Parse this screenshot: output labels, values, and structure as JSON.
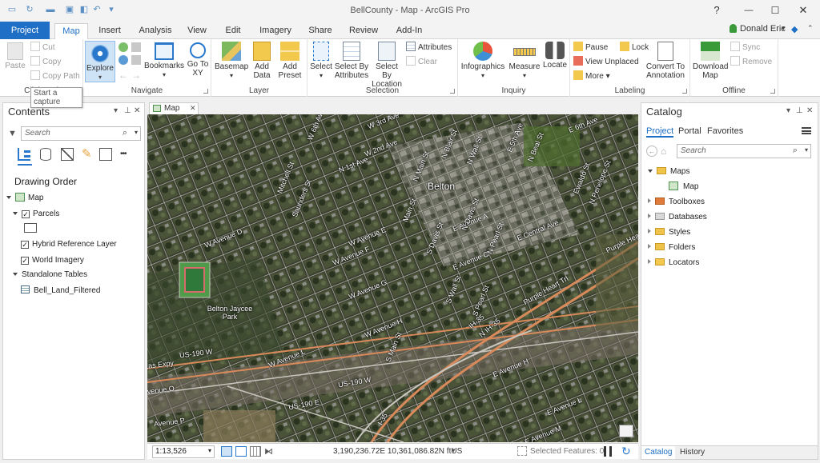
{
  "window": {
    "title": "BellCounty - Map - ArcGIS Pro",
    "user": "Donald Eric",
    "user_caret": "▾",
    "help": "?",
    "minimize": "—",
    "maximize": "☐",
    "close": "✕"
  },
  "ribbon_tabs": [
    "Project",
    "Map",
    "Insert",
    "Analysis",
    "View",
    "Edit",
    "Imagery",
    "Share",
    "Review",
    "Add-In"
  ],
  "ribbon": {
    "clipboard": {
      "label": "Clipboard",
      "paste": "Paste",
      "cut": "Cut",
      "copy": "Copy",
      "copy_path": "Copy Path",
      "tooltip": "Start a capture"
    },
    "navigate": {
      "label": "Navigate",
      "explore": "Explore",
      "bookmarks": "Bookmarks",
      "go_to_xy": "Go To XY"
    },
    "layer": {
      "label": "Layer",
      "basemap": "Basemap",
      "add_data": "Add Data",
      "add_preset": "Add Preset"
    },
    "selection": {
      "label": "Selection",
      "select": "Select",
      "select_by_attributes": "Select By Attributes",
      "select_by_location": "Select By Location",
      "attributes": "Attributes",
      "clear": "Clear"
    },
    "inquiry": {
      "label": "Inquiry",
      "infographics": "Infographics",
      "measure": "Measure",
      "locate": "Locate"
    },
    "labeling": {
      "label": "Labeling",
      "pause": "Pause",
      "lock": "Lock",
      "view_unplaced": "View Unplaced",
      "more": "More",
      "convert_to_annotation": "Convert To Annotation"
    },
    "offline": {
      "label": "Offline",
      "download_map": "Download Map",
      "sync": "Sync",
      "remove": "Remove"
    }
  },
  "contents": {
    "title": "Contents",
    "search_placeholder": "Search",
    "drawing_order": "Drawing Order",
    "more": "•••",
    "layers": [
      {
        "name": "Map"
      },
      {
        "name": "Parcels",
        "checked": true
      },
      {
        "name": "Hybrid Reference Layer",
        "checked": true
      },
      {
        "name": "World Imagery",
        "checked": true
      },
      {
        "name": "Standalone Tables"
      },
      {
        "name": "Bell_Land_Filtered"
      }
    ]
  },
  "map_tab": {
    "label": "Map"
  },
  "map_labels": [
    "W 2nd Ave",
    "N 1st Ave",
    "Belton",
    "W Avenue D",
    "W Avenue E",
    "W Avenue F",
    "W Avenue G",
    "W Avenue H",
    "E Avenue A",
    "E Central Ave",
    "E Avenue C",
    "Purple Heart Trl",
    "Purple Heart Trl",
    "US-190 W",
    "US-190 W",
    "US-190 E",
    "Belton Jaycee Park",
    "Main St",
    "Saunders St",
    "Mitchell St",
    "N Main St",
    "S Main St",
    "S Wall St",
    "S Pearl St",
    "N Wall St",
    "N Beal St",
    "W 6th Ave",
    "E 6th Ave",
    "E 5th Ave",
    "Ewaldo St",
    "IH-35",
    "N IH-35",
    "N Penelope St",
    "N Blair St",
    "E Avenue H",
    "E Avenue L",
    "I-35",
    "Avenue O",
    "Avenue P",
    "Las Expy",
    "N Davis St",
    "N Pearl St",
    "S Davis St",
    "W Avenue L",
    "W 3rd Ave",
    "E Avenue M"
  ],
  "status": {
    "scale": "1:13,526",
    "coordinates": "3,190,236.72E 10,361,086.82N ftUS",
    "selected_features": "Selected Features: 0"
  },
  "catalog": {
    "title": "Catalog",
    "tabs": [
      "Project",
      "Portal",
      "Favorites"
    ],
    "search_placeholder": "Search",
    "items": [
      {
        "name": "Maps",
        "expanded": true
      },
      {
        "name": "Map",
        "child": true
      },
      {
        "name": "Toolboxes"
      },
      {
        "name": "Databases"
      },
      {
        "name": "Styles"
      },
      {
        "name": "Folders"
      },
      {
        "name": "Locators"
      }
    ],
    "bottom_tabs": [
      "Catalog",
      "History"
    ]
  },
  "colors": {
    "accent": "#1e6fc5",
    "folder": "#f0c44a"
  }
}
